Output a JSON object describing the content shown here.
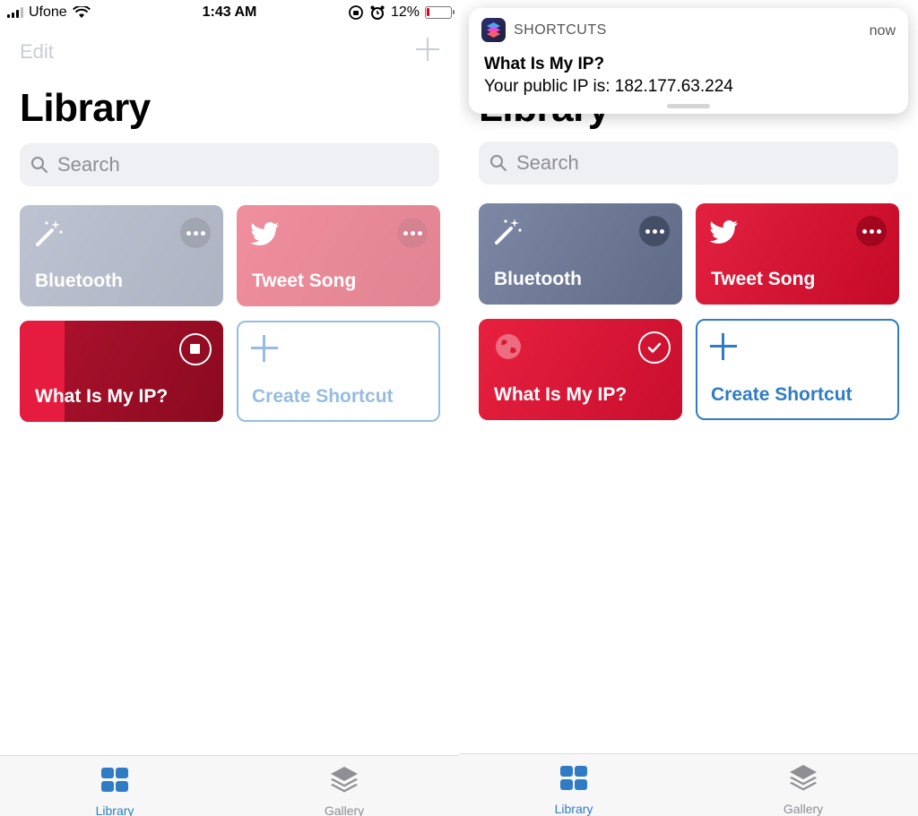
{
  "left": {
    "status": {
      "carrier": "Ufone",
      "time": "1:43 AM",
      "battery": "12%",
      "battery_level": 0.12
    },
    "nav": {
      "edit_label": "Edit"
    },
    "title": "Library",
    "search": {
      "placeholder": "Search"
    },
    "cards": {
      "bluetooth": {
        "label": "Bluetooth",
        "icon": "magic-wand-icon"
      },
      "tweet_song": {
        "label": "Tweet Song",
        "icon": "twitter-bird-icon"
      },
      "what_is_my_ip": {
        "label": "What Is My IP?",
        "state": "running"
      },
      "create": {
        "label": "Create Shortcut"
      }
    },
    "tabs": {
      "library": "Library",
      "gallery": "Gallery"
    }
  },
  "right": {
    "notification": {
      "app_name": "SHORTCUTS",
      "time": "now",
      "title": "What Is My IP?",
      "body": "Your public IP is: 182.177.63.224"
    },
    "title": "Library",
    "search": {
      "placeholder": "Search"
    },
    "cards": {
      "bluetooth": {
        "label": "Bluetooth",
        "icon": "magic-wand-icon"
      },
      "tweet_song": {
        "label": "Tweet Song",
        "icon": "twitter-bird-icon"
      },
      "what_is_my_ip": {
        "label": "What Is My IP?",
        "icon": "globe-icon",
        "state": "completed"
      },
      "create": {
        "label": "Create Shortcut"
      }
    },
    "tabs": {
      "library": "Library",
      "gallery": "Gallery"
    }
  },
  "colors": {
    "accent": "#2f7cc4",
    "bluetooth_card": "#6f7a95",
    "tweet_card": "#d8112f",
    "ip_card": "#d81338"
  }
}
